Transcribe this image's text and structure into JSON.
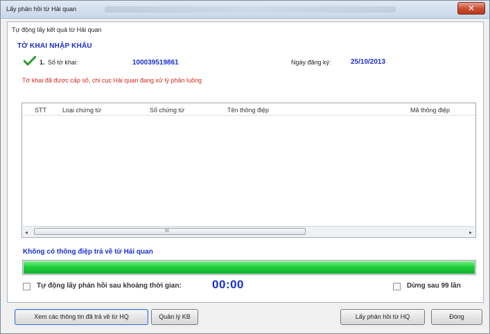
{
  "window": {
    "title": "Lấy phản hồi từ Hải quan",
    "close_label": "✕"
  },
  "header": {
    "auto_label": "Tự động lấy kết quả từ Hải quan",
    "declaration_type": "TỜ KHAI NHẬP KHẨU",
    "item_index": "1.",
    "number_label": "Số tờ khai:",
    "number_value": "100039519861",
    "date_label": "Ngày đăng ký:",
    "date_value": "25/10/2013",
    "status_message": "Tờ khai đã được cấp số, chi cục Hải quan đang xử lý phân luồng"
  },
  "table": {
    "columns": [
      "STT",
      "Loại chứng từ",
      "Số chứng từ",
      "Tên thông điệp",
      "Mã thông điệp"
    ],
    "rows": [],
    "scroll_grip": "III"
  },
  "progress": {
    "message": "Không có thông điệp trả về từ Hải quan",
    "value_percent": 100,
    "fill_color": "#1fcf3d"
  },
  "options": {
    "auto_fetch_label": "Tự động lấy phản hồi sau khoảng thời gian:",
    "auto_fetch_checked": false,
    "timer": "00:00",
    "stop_after_label": "Dừng sau 99 lần",
    "stop_after_checked": false
  },
  "buttons": {
    "view_info": "Xem các thông tin đã trả về từ HQ",
    "manage_kb": "Quản lý KB",
    "get_response": "Lấy phản hồi từ HQ",
    "close": "Đóng"
  },
  "colors": {
    "accent_blue": "#1a2fd0",
    "error_red": "#d7261c",
    "success_green": "#1fcf3d"
  }
}
